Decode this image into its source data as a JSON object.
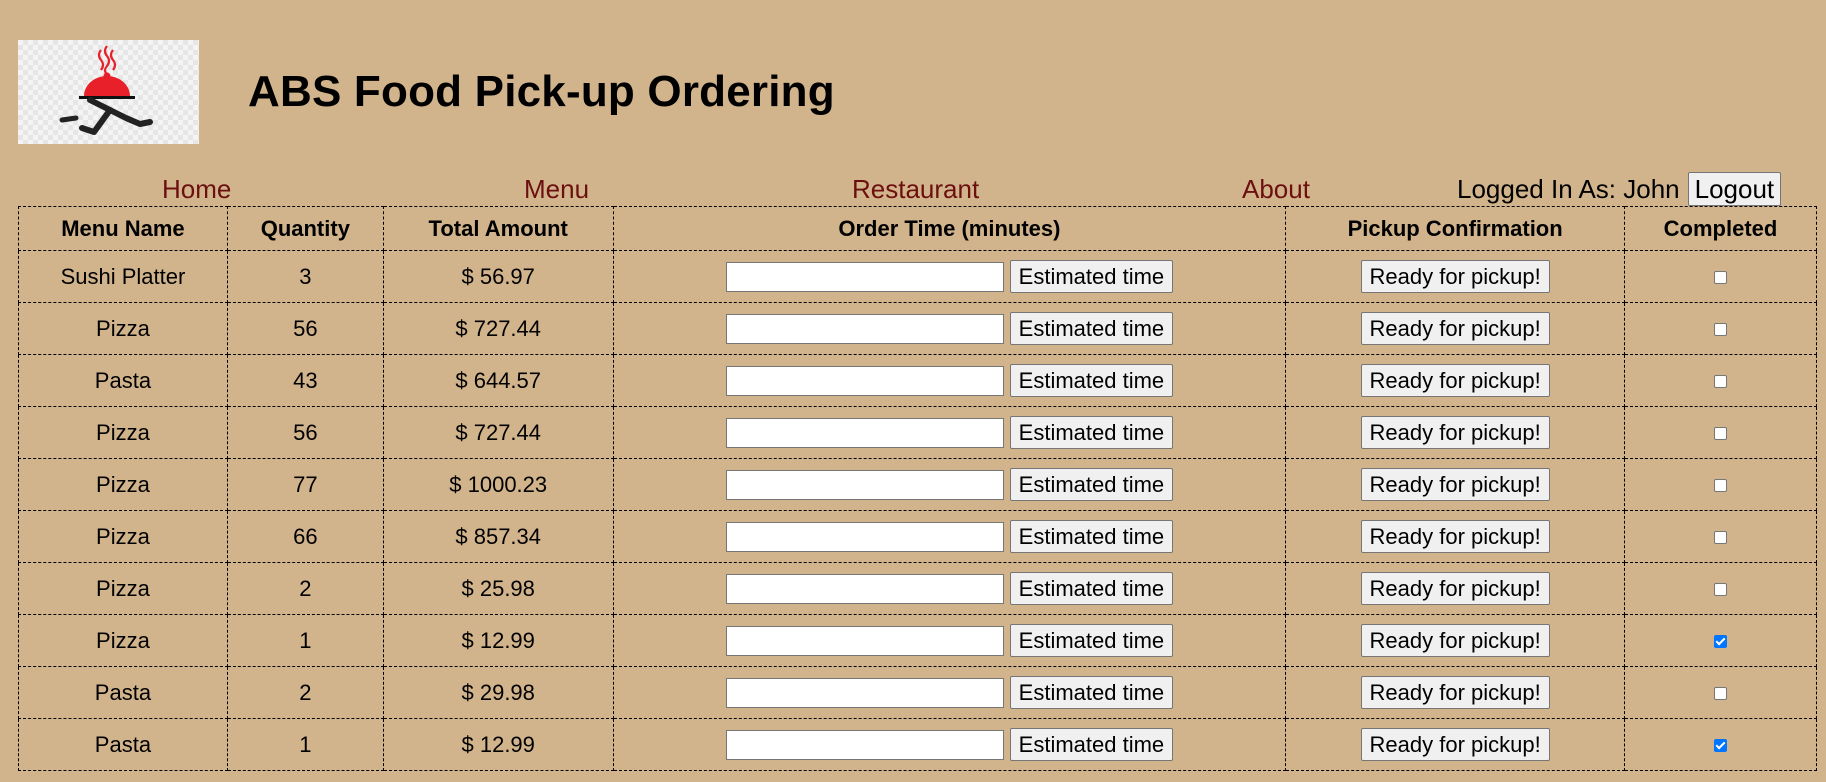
{
  "header": {
    "title": "ABS Food Pick-up Ordering",
    "logo_icon": "food-delivery-logo-icon"
  },
  "nav": {
    "home": "Home",
    "menu": "Menu",
    "restaurant": "Restaurant",
    "about": "About",
    "logged_in_text": "Logged In As: John",
    "logout_label": "Logout"
  },
  "table": {
    "headers": [
      "Menu Name",
      "Quantity",
      "Total Amount",
      "Order Time (minutes)",
      "Pickup Confirmation",
      "Completed"
    ],
    "estimate_label": "Estimated time",
    "pickup_label": "Ready for pickup!",
    "rows": [
      {
        "name": "Sushi Platter",
        "qty": "3",
        "total": "$ 56.97",
        "order_time": "",
        "completed": false
      },
      {
        "name": "Pizza",
        "qty": "56",
        "total": "$ 727.44",
        "order_time": "",
        "completed": false
      },
      {
        "name": "Pasta",
        "qty": "43",
        "total": "$ 644.57",
        "order_time": "",
        "completed": false
      },
      {
        "name": "Pizza",
        "qty": "56",
        "total": "$ 727.44",
        "order_time": "",
        "completed": false
      },
      {
        "name": "Pizza",
        "qty": "77",
        "total": "$ 1000.23",
        "order_time": "",
        "completed": false
      },
      {
        "name": "Pizza",
        "qty": "66",
        "total": "$ 857.34",
        "order_time": "",
        "completed": false
      },
      {
        "name": "Pizza",
        "qty": "2",
        "total": "$ 25.98",
        "order_time": "",
        "completed": false
      },
      {
        "name": "Pizza",
        "qty": "1",
        "total": "$ 12.99",
        "order_time": "",
        "completed": true
      },
      {
        "name": "Pasta",
        "qty": "2",
        "total": "$ 29.98",
        "order_time": "",
        "completed": false
      },
      {
        "name": "Pasta",
        "qty": "1",
        "total": "$ 12.99",
        "order_time": "",
        "completed": true
      }
    ]
  },
  "colors": {
    "background": "#d2b48c",
    "nav_link": "#6b0f0f",
    "logo_red": "#e8202a",
    "checkbox_blue": "#0075ff"
  }
}
